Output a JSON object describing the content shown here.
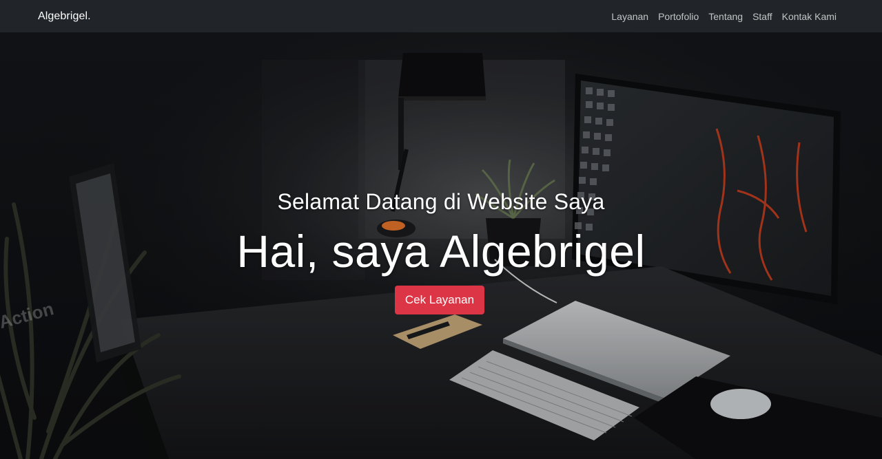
{
  "navbar": {
    "brand": "Algebrigel.",
    "links": [
      "Layanan",
      "Portofolio",
      "Tentang",
      "Staff",
      "Kontak Kami"
    ]
  },
  "hero": {
    "subtitle": "Selamat Datang di Website Saya",
    "headline": "Hai, saya Algebrigel",
    "cta_label": "Cek Layanan",
    "background_image": "dark desk workspace with monitor, lamp, plant, laptop and keyboard"
  },
  "colors": {
    "navbar_bg": "#212529",
    "cta_bg": "#dc3545",
    "text": "#ffffff"
  }
}
